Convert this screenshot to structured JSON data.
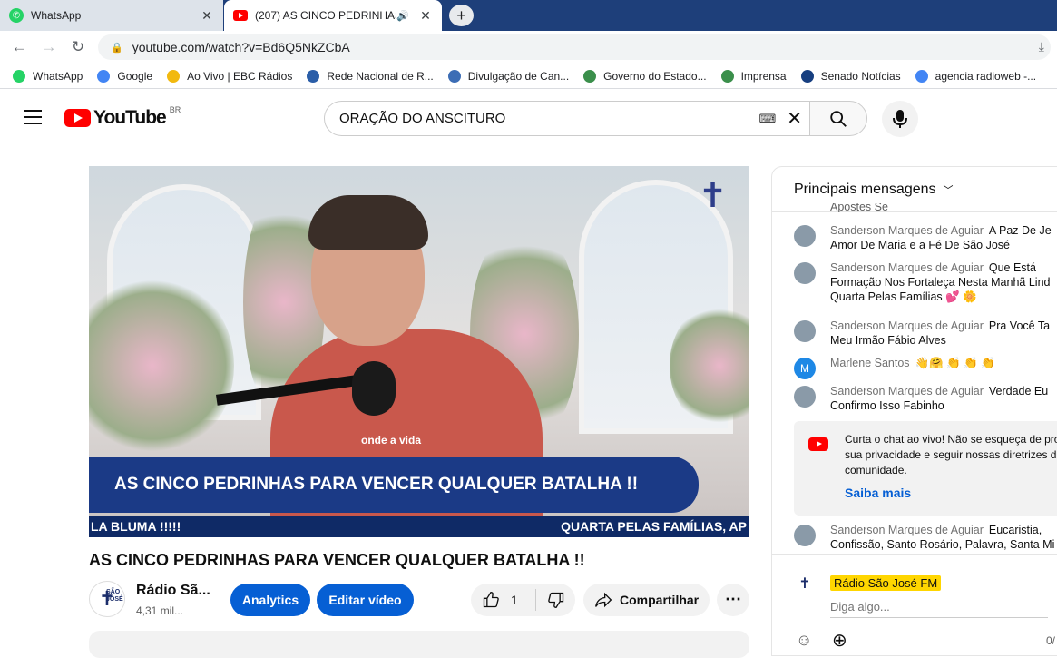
{
  "tabs": [
    {
      "title": "WhatsApp"
    },
    {
      "title": "(207) AS CINCO PEDRINHAS"
    }
  ],
  "omnibox": {
    "url": "youtube.com/watch?v=Bd6Q5NkZCbA"
  },
  "bookmarks": [
    {
      "label": "WhatsApp",
      "color": "#25d366"
    },
    {
      "label": "Google",
      "color": "#4285f4"
    },
    {
      "label": "Ao Vivo | EBC Rádios",
      "color": "#f2b90f"
    },
    {
      "label": "Rede Nacional de R...",
      "color": "#2b5ea8"
    },
    {
      "label": "Divulgação de Can...",
      "color": "#3c6db5"
    },
    {
      "label": "Governo do Estado...",
      "color": "#3b8f4b"
    },
    {
      "label": "Imprensa",
      "color": "#3b8f4b"
    },
    {
      "label": "Senado Notícias",
      "color": "#173f80"
    },
    {
      "label": "agencia radioweb -...",
      "color": "#4285f4"
    }
  ],
  "youtube": {
    "logo_text": "YouTube",
    "region": "BR",
    "search_query": "ORAÇÃO DO ANSCITURO"
  },
  "video": {
    "banner_text": "AS CINCO PEDRINHAS PARA VENCER QUALQUER BATALHA !!",
    "ticker_left": "LA BLUMA !!!!!",
    "ticker_right": "QUARTA PELAS FAMÍLIAS, AP",
    "shirt_text": "onde a vida",
    "title": "AS CINCO PEDRINHAS PARA VENCER QUALQUER BATALHA !!"
  },
  "channel": {
    "name": "Rádio Sã...",
    "subs": "4,31 mil...",
    "avatar_text": "SÃO JOSÉ"
  },
  "actions": {
    "analytics": "Analytics",
    "edit": "Editar vídeo",
    "likes": "1",
    "share": "Compartilhar"
  },
  "chat": {
    "header": "Principais mensagens",
    "top_fragment": "Apostes Se",
    "messages": [
      {
        "author": "Sanderson Marques de Aguiar",
        "l1": "A Paz De Je",
        "l2": "Amor De Maria e a Fé De São José"
      },
      {
        "author": "Sanderson Marques de Aguiar",
        "l1": "Que Está",
        "l2": "Formação Nos Fortaleça Nesta Manhã Lind",
        "l3": "Quarta Pelas Famílias 💕 🌼"
      },
      {
        "author": "Sanderson Marques de Aguiar",
        "l1": "Pra Você Ta",
        "l2": "Meu Irmão Fábio Alves"
      },
      {
        "author": "Marlene Santos",
        "l1": "👋🤗 👏 👏 👏",
        "avatar_letter": "M"
      },
      {
        "author": "Sanderson Marques de Aguiar",
        "l1": "Verdade Eu",
        "l2": "Confirmo Isso Fabinho"
      },
      {
        "author": "Sanderson Marques de Aguiar",
        "l1": "Eucaristia,",
        "l2": "Confissão, Santo Rosário, Palavra, Santa Mi"
      }
    ],
    "notice_text": "Curta o chat ao vivo! Não se esqueça de pro sua privacidade e seguir nossas diretrizes da comunidade.",
    "notice_link": "Saiba mais",
    "me_name": "Rádio São José FM",
    "input_placeholder": "Diga algo...",
    "char_count": "0/"
  }
}
